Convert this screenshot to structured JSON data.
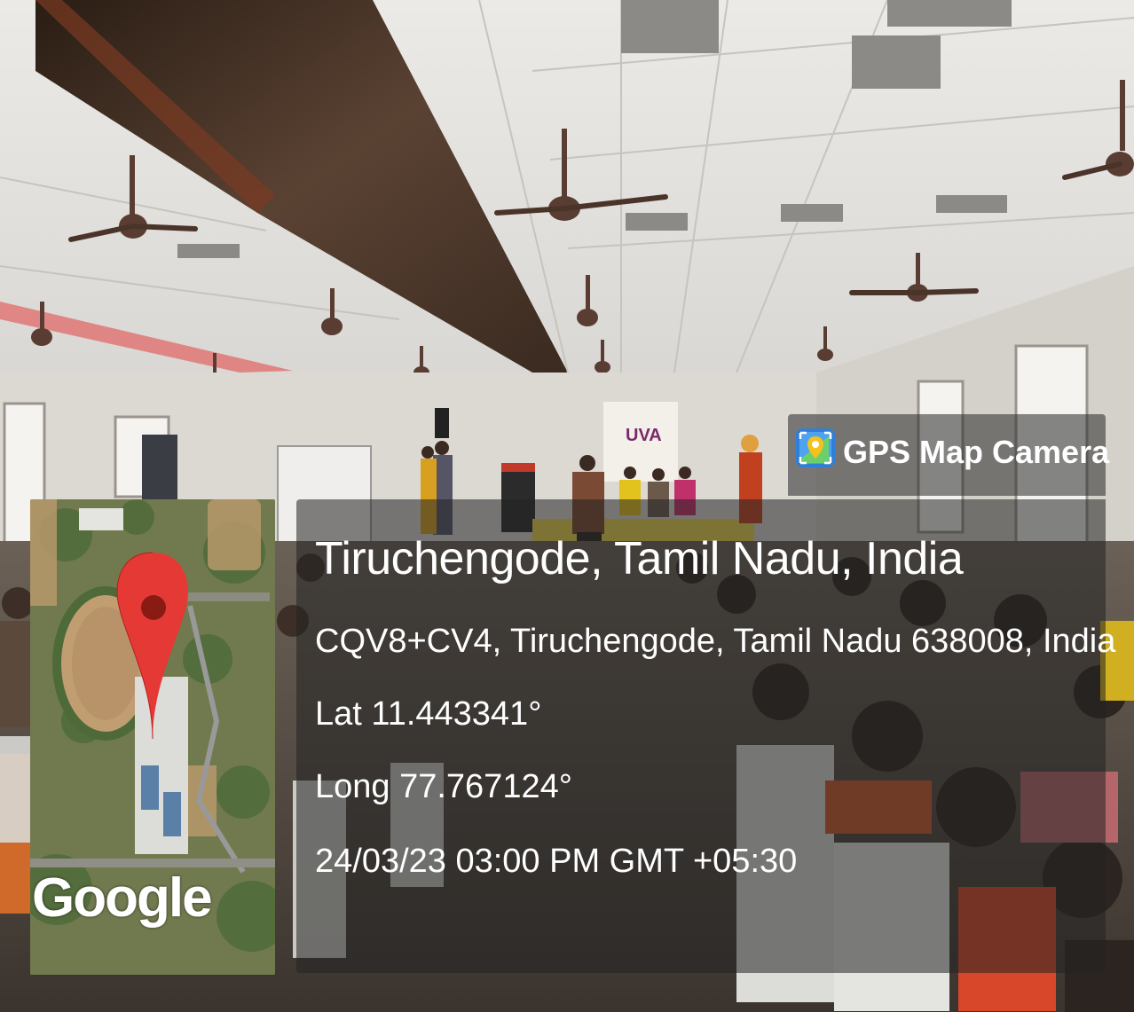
{
  "app": {
    "name": "GPS Map Camera",
    "icon": "gps-map-camera-app-icon"
  },
  "location": {
    "title": "Tiruchengode, Tamil Nadu, India",
    "address": "CQV8+CV4, Tiruchengode, Tamil Nadu 638008, India",
    "latitude": "Lat 11.443341°",
    "longitude": "Long 77.767124°",
    "datetime": "24/03/23 03:00 PM GMT +05:30"
  },
  "map": {
    "watermark": "Google",
    "marker_icon": "map-pin-icon"
  },
  "banner": {
    "text": "UVA"
  },
  "colors": {
    "pin": "#e53935",
    "panel": "#232323",
    "ceiling": "#e8e6e2"
  }
}
